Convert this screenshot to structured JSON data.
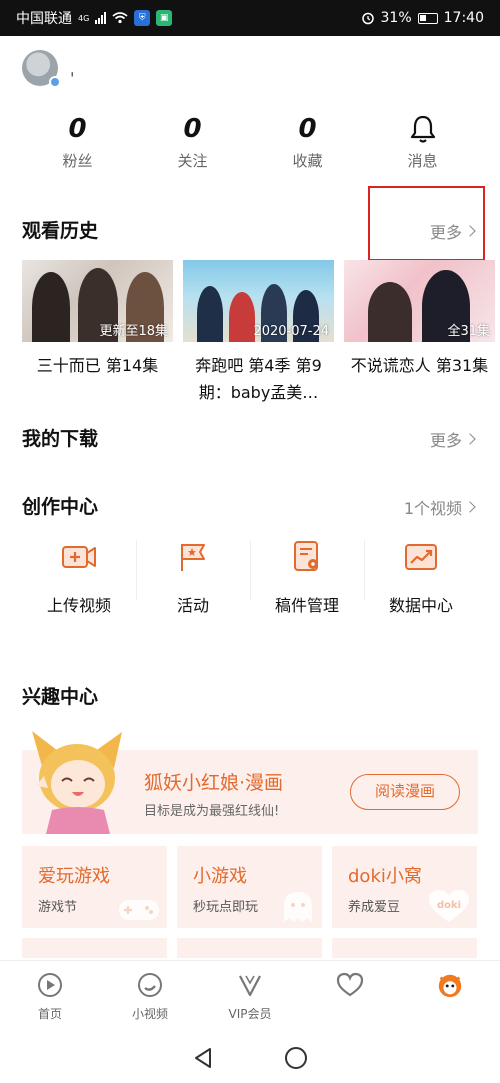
{
  "status_bar": {
    "carrier": "中国联通",
    "network": "4G",
    "battery": "31%",
    "time": "17:40"
  },
  "profile": {
    "username": "ˌ"
  },
  "stats": [
    {
      "value": "0",
      "label": "粉丝"
    },
    {
      "value": "0",
      "label": "关注"
    },
    {
      "value": "0",
      "label": "收藏"
    }
  ],
  "messages": {
    "label": "消息",
    "icon": "bell-icon"
  },
  "history": {
    "title": "观看历史",
    "more": "更多",
    "items": [
      {
        "caption": "更新至18集",
        "title": "三十而已 第14集"
      },
      {
        "caption": "2020-07-24",
        "title": "奔跑吧 第4季 第9期：baby孟美…"
      },
      {
        "caption": "全31集",
        "title": "不说谎恋人 第31集"
      }
    ]
  },
  "downloads": {
    "title": "我的下载",
    "more": "更多"
  },
  "create_center": {
    "title": "创作中心",
    "more": "1个视频",
    "items": [
      {
        "label": "上传视频",
        "icon": "upload-video-icon"
      },
      {
        "label": "活动",
        "icon": "activity-flag-icon"
      },
      {
        "label": "稿件管理",
        "icon": "manuscript-icon"
      },
      {
        "label": "数据中心",
        "icon": "data-chart-icon"
      }
    ]
  },
  "interest": {
    "title": "兴趣中心",
    "banner": {
      "title": "狐妖小红娘·漫画",
      "subtitle": "目标是成为最强红线仙!",
      "button": "阅读漫画"
    },
    "cards": [
      {
        "title": "爱玩游戏",
        "subtitle": "游戏节",
        "icon": "gamepad-icon"
      },
      {
        "title": "小游戏",
        "subtitle": "秒玩点即玩",
        "icon": "ghost-icon"
      },
      {
        "title": "doki小窝",
        "subtitle": "养成爱豆",
        "icon": "doki-heart-icon",
        "badge": "doki"
      }
    ]
  },
  "bottom_nav": [
    {
      "label": "首页",
      "icon": "home-play-icon"
    },
    {
      "label": "小视频",
      "icon": "short-video-icon"
    },
    {
      "label": "VIP会员",
      "icon": "vip-icon"
    },
    {
      "label": "",
      "icon": "heart-icon"
    },
    {
      "label": "",
      "icon": "profile-mascot-icon"
    }
  ],
  "colors": {
    "accent": "#e36a2e",
    "card_bg": "#fdf0ec",
    "highlight": "#dd2222"
  }
}
